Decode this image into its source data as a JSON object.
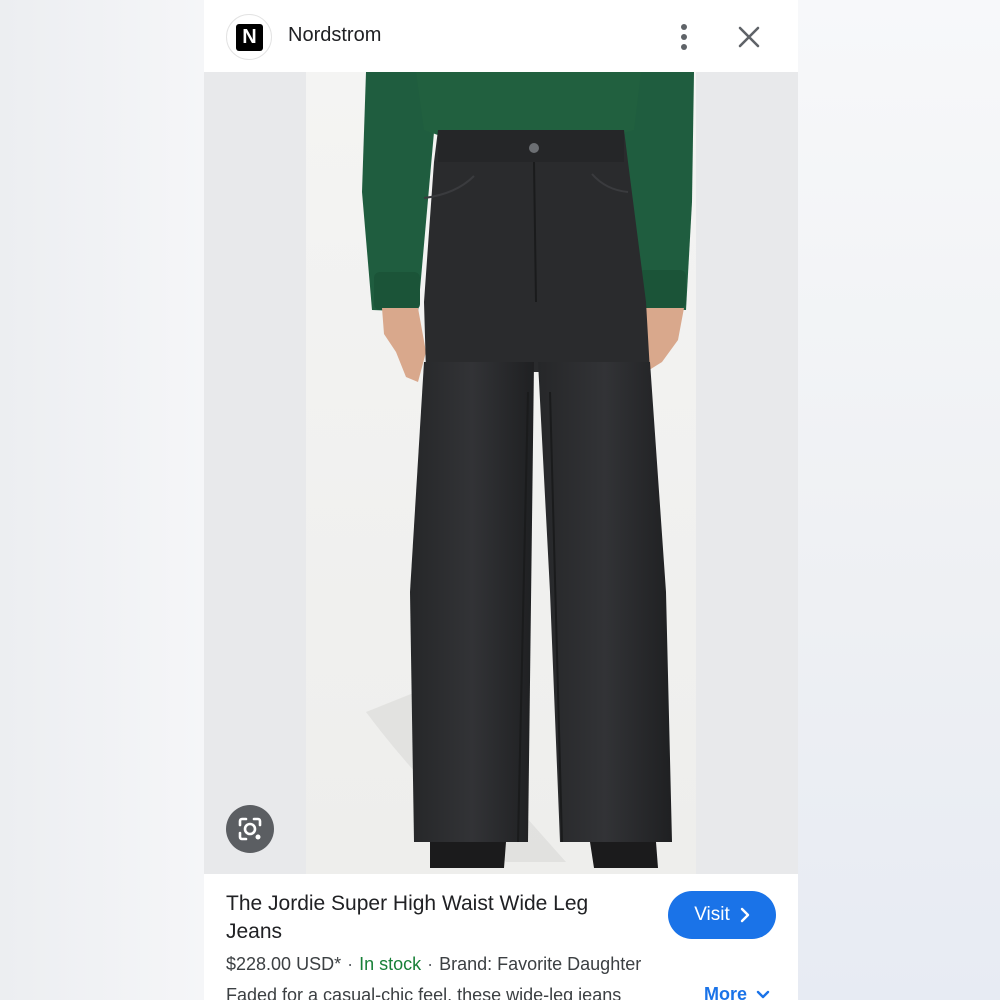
{
  "header": {
    "favicon_letter": "N",
    "site_name": "Nordstrom"
  },
  "product": {
    "title": "The Jordie Super High Waist Wide Leg Jeans",
    "price": "$228.00 USD*",
    "availability": "In stock",
    "brand": "Brand: Favorite Daughter",
    "description": "Faded for a casual-chic feel, these wide-leg jeans",
    "separator": "·"
  },
  "actions": {
    "visit_label": "Visit",
    "more_label": "More"
  },
  "icons": {
    "menu": "more-vert-icon",
    "close": "close-icon",
    "lens": "google-lens-icon",
    "visit_arrow": "chevron-right-icon",
    "more_arrow": "chevron-down-icon"
  },
  "colors": {
    "accent": "#1a73e8",
    "in_stock": "#188038",
    "sweater": "#1f5d3f",
    "denim": "#2a2b2d"
  }
}
